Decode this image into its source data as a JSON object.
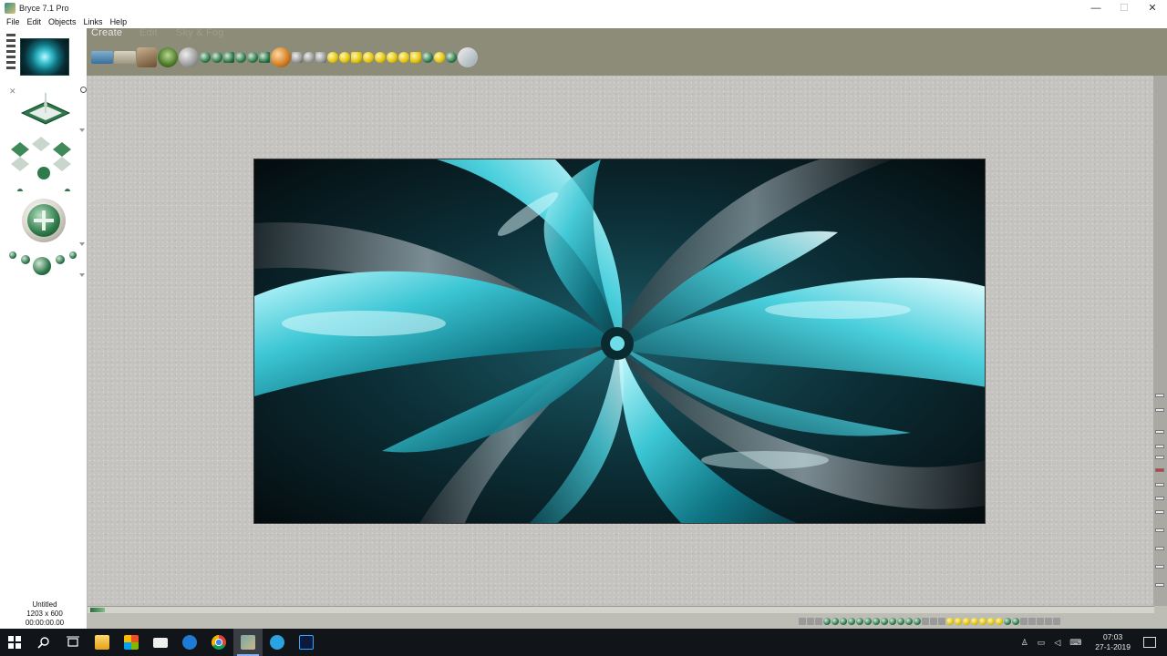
{
  "window": {
    "title": "Bryce 7.1  Pro",
    "controls": {
      "minimize": "—",
      "maximize": "☐",
      "close": "✕"
    }
  },
  "menu": [
    "File",
    "Edit",
    "Objects",
    "Links",
    "Help"
  ],
  "palette_tabs": {
    "create": "Create",
    "edit": "Edit",
    "sky_fog": "Sky & Fog"
  },
  "document": {
    "name": "Untitled",
    "size": "1203 x 600",
    "time": "00:00:00.00"
  },
  "taskbar": {
    "apps": [
      "start",
      "search",
      "task-view",
      "file-explorer",
      "store",
      "mail",
      "edge",
      "chrome",
      "bryce",
      "telegram",
      "photoshop"
    ],
    "active_app": "bryce",
    "tray": {
      "time": "07:03",
      "date": "27-1-2019"
    }
  },
  "colors": {
    "accent_green": "#2e7a4c",
    "workspace": "#bdbcb5",
    "top_band": "#8d8c79",
    "render_cyan": "#3bc2d0"
  },
  "icons": {
    "start": "windows-logo-icon",
    "search": "search-icon",
    "task_view": "task-view-icon",
    "notifications": "notification-icon"
  }
}
